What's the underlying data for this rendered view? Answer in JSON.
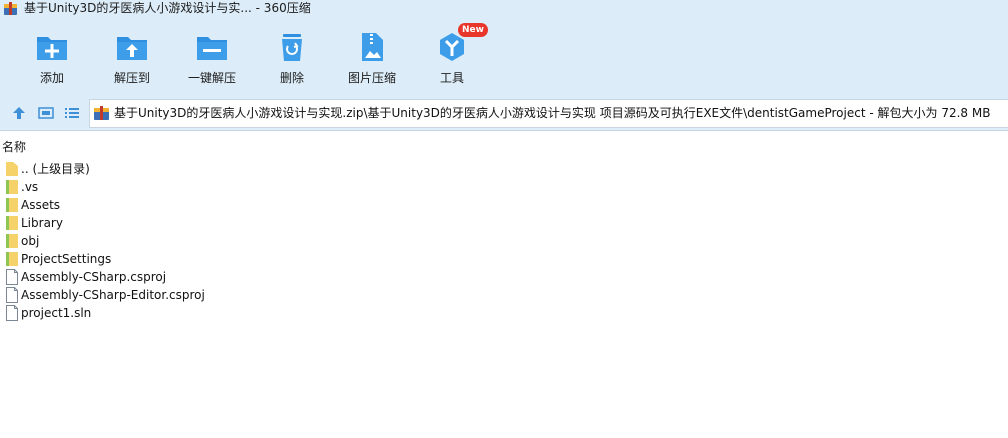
{
  "window": {
    "title": "基于Unity3D的牙医病人小游戏设计与实... - 360压缩"
  },
  "toolbar": {
    "items": [
      {
        "label": "添加",
        "icon": "add-icon"
      },
      {
        "label": "解压到",
        "icon": "extract-to-icon"
      },
      {
        "label": "一键解压",
        "icon": "one-click-extract-icon"
      },
      {
        "label": "删除",
        "icon": "delete-icon"
      },
      {
        "label": "图片压缩",
        "icon": "image-compress-icon"
      },
      {
        "label": "工具",
        "icon": "tools-icon",
        "badge": "New"
      }
    ]
  },
  "address": {
    "path": "基于Unity3D的牙医病人小游戏设计与实现.zip\\基于Unity3D的牙医病人小游戏设计与实现 项目源码及可执行EXE文件\\dentistGameProject - 解包大小为 72.8 MB"
  },
  "list": {
    "column_name": "名称",
    "rows": [
      {
        "name": ".. (上级目录)",
        "type": "parent"
      },
      {
        "name": ".vs",
        "type": "folder"
      },
      {
        "name": "Assets",
        "type": "folder"
      },
      {
        "name": "Library",
        "type": "folder"
      },
      {
        "name": "obj",
        "type": "folder"
      },
      {
        "name": "ProjectSettings",
        "type": "folder"
      },
      {
        "name": "Assembly-CSharp.csproj",
        "type": "file"
      },
      {
        "name": "Assembly-CSharp-Editor.csproj",
        "type": "file"
      },
      {
        "name": "project1.sln",
        "type": "file"
      }
    ]
  },
  "colors": {
    "toolbar_bg": "#dcecf8",
    "icon_blue": "#2f8fe0",
    "folder_yellow": "#f6d26b",
    "badge_red": "#e8362b"
  }
}
